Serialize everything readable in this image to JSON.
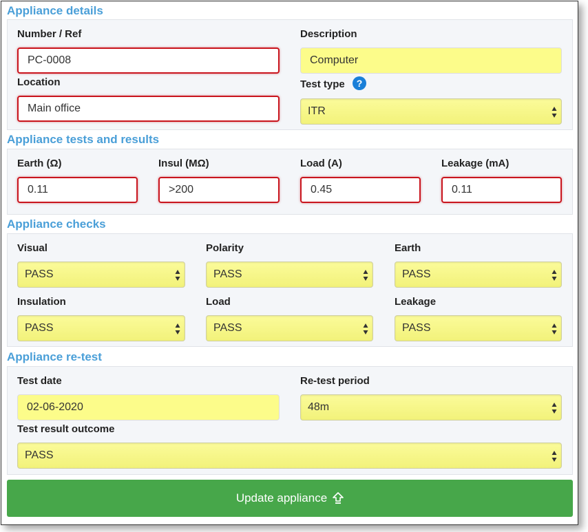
{
  "sections": {
    "details": "Appliance details",
    "tests": "Appliance tests and results",
    "checks": "Appliance checks",
    "retest": "Appliance re-test"
  },
  "details": {
    "number_label": "Number / Ref",
    "number_value": "PC-0008",
    "description_label": "Description",
    "description_value": "Computer",
    "location_label": "Location",
    "location_value": "Main office",
    "test_type_label": "Test type",
    "test_type_value": "ITR",
    "help_icon": "question-circle-icon"
  },
  "tests": {
    "earth_label": "Earth (Ω)",
    "earth_value": "0.11",
    "insul_label": "Insul (MΩ)",
    "insul_value": ">200",
    "load_label": "Load (A)",
    "load_value": "0.45",
    "leakage_label": "Leakage (mA)",
    "leakage_value": "0.11"
  },
  "checks": {
    "visual_label": "Visual",
    "visual_value": "PASS",
    "polarity_label": "Polarity",
    "polarity_value": "PASS",
    "earth_label": "Earth",
    "earth_value": "PASS",
    "insulation_label": "Insulation",
    "insulation_value": "PASS",
    "load_label": "Load",
    "load_value": "PASS",
    "leakage_label": "Leakage",
    "leakage_value": "PASS"
  },
  "retest": {
    "date_label": "Test date",
    "date_value": "02-06-2020",
    "period_label": "Re-test period",
    "period_value": "48m",
    "outcome_label": "Test result outcome",
    "outcome_value": "PASS"
  },
  "update_button": {
    "label": "Update appliance",
    "icon": "upload-arrow-icon"
  },
  "colors": {
    "section_title": "#4a9fd8",
    "error_border": "#c9151e",
    "highlight": "#fcfc8a",
    "button": "#47a74a"
  }
}
